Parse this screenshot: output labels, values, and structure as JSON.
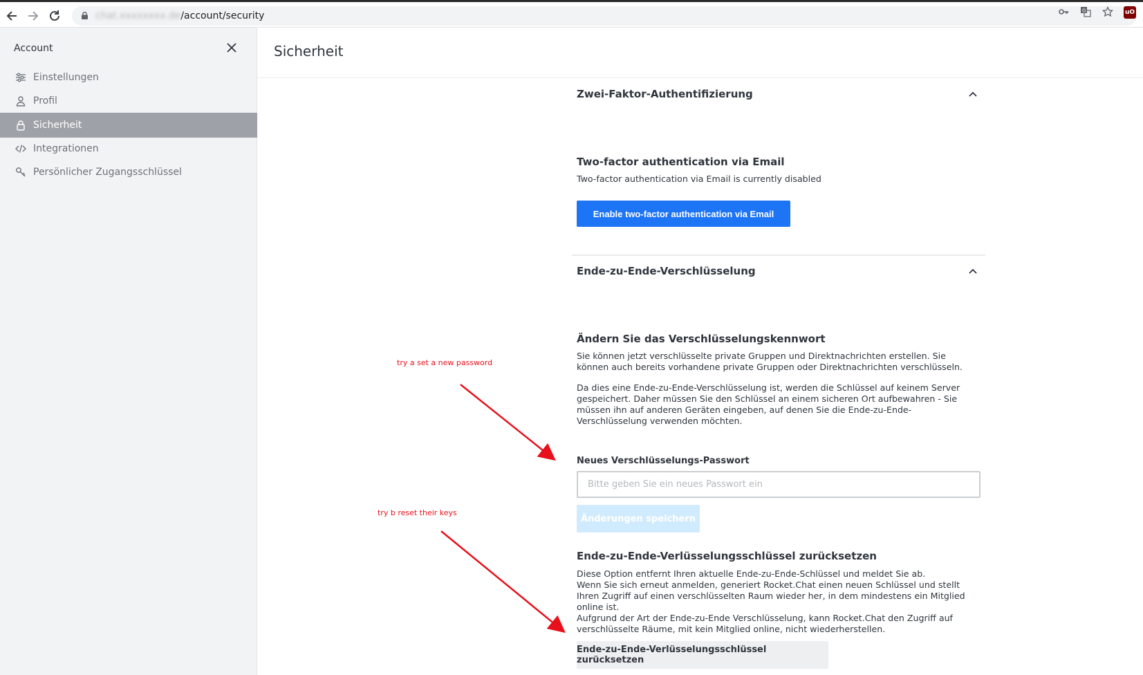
{
  "browser": {
    "url_host": "chat.xxxxxxxx.de",
    "url_path": "/account/security",
    "icons": [
      "key-icon",
      "translate-icon",
      "star-icon",
      "ublock-icon"
    ],
    "ublock_label": "uO"
  },
  "sidebar": {
    "title": "Account",
    "items": [
      {
        "label": "Einstellungen",
        "icon": "sliders-icon"
      },
      {
        "label": "Profil",
        "icon": "user-icon"
      },
      {
        "label": "Sicherheit",
        "icon": "lock-icon",
        "active": true
      },
      {
        "label": "Integrationen",
        "icon": "code-icon"
      },
      {
        "label": "Persönlicher Zugangsschlüssel",
        "icon": "key-icon"
      }
    ]
  },
  "main": {
    "title": "Sicherheit",
    "twofa": {
      "section_title": "Zwei-Faktor-Authentifizierung",
      "email_title": "Two-factor authentication via Email",
      "email_status": "Two-factor authentication via Email is currently disabled",
      "enable_button": "Enable two-factor authentication via Email"
    },
    "e2e": {
      "section_title": "Ende-zu-Ende-Verschlüsselung",
      "change_title": "Ändern Sie das Verschlüsselungskennwort",
      "change_p1": "Sie können jetzt verschlüsselte private Gruppen und Direktnachrichten erstellen. Sie können auch bereits vorhandene private Gruppen oder Direktnachrichten verschlüsseln.",
      "change_p2": "Da dies eine Ende-zu-Ende-Verschlüsselung ist, werden die Schlüssel auf keinem Server gespeichert. Daher müssen Sie den Schlüssel an einem sicheren Ort aufbewahren - Sie müssen ihn auf anderen Geräten eingeben, auf denen Sie die Ende-zu-Ende-Verschlüsselung verwenden möchten.",
      "password_label": "Neues Verschlüsselungs-Passwort",
      "password_placeholder": "Bitte geben Sie ein neues Passwort ein",
      "save_button": "Änderungen speichern",
      "reset_title": "Ende-zu-Ende-Verlüsselungsschlüssel zurücksetzen",
      "reset_p": "Diese Option entfernt Ihren aktuelle Ende-zu-Ende-Schlüssel und meldet Sie ab.\nWenn Sie sich erneut anmelden, generiert Rocket.Chat einen neuen Schlüssel und stellt Ihren Zugriff auf einen verschlüsselten Raum wieder her, in dem mindestens ein Mitglied online ist.\nAufgrund der Art der Ende-zu-Ende Verschlüsselung, kann Rocket.Chat den Zugriff auf verschlüsselte Räume, mit kein Mitglied online, nicht wiederherstellen.",
      "reset_button": "Ende-zu-Ende-Verlüsselungsschlüssel zurücksetzen"
    }
  },
  "annotations": {
    "note1": "try a set a new password",
    "note2": "try b reset their keys",
    "color": "#e8101a"
  }
}
